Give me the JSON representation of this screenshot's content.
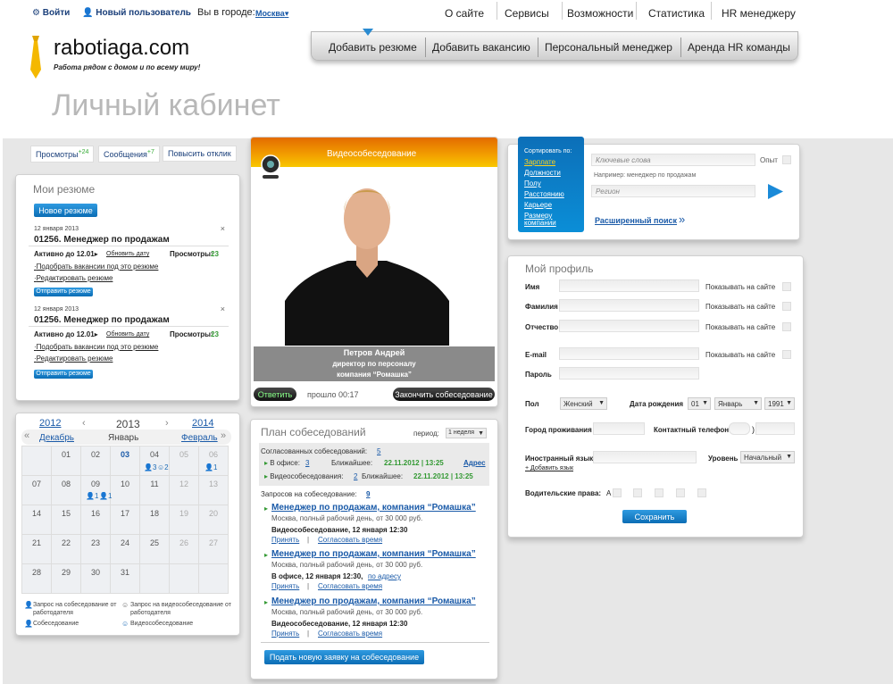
{
  "top": {
    "login": "Войти",
    "new_user": "Новый пользователь",
    "city_label": "Вы в городе:",
    "city": "Москва",
    "nav": [
      "О сайте",
      "Сервисы",
      "Возможности",
      "Статистика",
      "HR менеджеру"
    ]
  },
  "logo": {
    "name": "rabotiaga.com",
    "tagline": "Работа рядом с домом и по всему миру!"
  },
  "mainnav": [
    "Добавить резюме",
    "Добавить вакансию",
    "Персональный менеджер",
    "Аренда HR команды"
  ],
  "page_title": "Личный кабинет",
  "quick": {
    "views": "Просмотры",
    "views_count": "+24",
    "messages": "Сообщения",
    "messages_count": "+7",
    "boost": "Повысить отклик"
  },
  "resumes": {
    "title": "Мои резюме",
    "new_button": "Новое резюме",
    "items": [
      {
        "date": "12 января 2013",
        "title": "01256. Менеджер по продажам",
        "active": "Активно до 12.01",
        "update": "Обновить дату",
        "views_label": "Просмотры:",
        "views": "23",
        "match": "Подобрать вакансии под это резюме",
        "edit": "Редактировать резюме",
        "send": "Отправить резюме"
      },
      {
        "date": "12 января 2013",
        "title": "01256. Менеджер по продажам",
        "active": "Активно до 12.01",
        "update": "Обновить дату",
        "views_label": "Просмотры:",
        "views": "23",
        "match": "Подобрать вакансии под это резюме",
        "edit": "Редактировать резюме",
        "send": "Отправить резюме"
      }
    ]
  },
  "calendar": {
    "prev_year": "2012",
    "year": "2013",
    "next_year": "2014",
    "prev_month": "Декабрь",
    "month": "Январь",
    "next_month": "Февраль",
    "rows": [
      [
        "",
        "01",
        "02",
        "03",
        "04",
        "05",
        "06"
      ],
      [
        "07",
        "08",
        "09",
        "10",
        "11",
        "12",
        "13"
      ],
      [
        "14",
        "15",
        "16",
        "17",
        "18",
        "19",
        "20"
      ],
      [
        "21",
        "22",
        "23",
        "24",
        "25",
        "26",
        "27"
      ],
      [
        "28",
        "29",
        "30",
        "31",
        "",
        "",
        ""
      ]
    ],
    "badges": {
      "d04a": "3",
      "d04b": "2",
      "d06": "1",
      "d09": "1",
      "d10": "1"
    },
    "legend": {
      "employer_request": "Запрос на собеседование от работодателя",
      "video_request": "Запрос на видеособеседование от работодателя",
      "interview": "Собеседование",
      "video_interview": "Видеособеседование"
    }
  },
  "video": {
    "title": "Видеособеседование",
    "name": "Петров Андрей",
    "position": "директор по персоналу",
    "company": "компания “Ромашка”",
    "answer": "Ответить",
    "elapsed": "прошло 00:17",
    "end": "Закончить собеседование"
  },
  "plan": {
    "title": "План собеседований",
    "period_label": "период:",
    "period": "1 неделя",
    "agreed_label": "Согласованных собеседований:",
    "agreed": "5",
    "office_label": "В офисе:",
    "office_count": "3",
    "nearest_label": "Ближайшее:",
    "office_nearest": "22.11.2012 | 13:25",
    "address": "Адрес",
    "video_label": "Видеособеседования:",
    "video_count": "2",
    "video_nearest": "22.11.2012 | 13:25",
    "requests_label": "Запросов на собеседование:",
    "requests": "9",
    "items": [
      {
        "title": "Менеджер по продажам, компания “Ромашка”",
        "desc": "Москва, полный рабочий день, от 30 000 руб.",
        "when": "Видеособеседование, 12 января 12:30",
        "addr": "",
        "accept": "Принять",
        "other": "Согласовать время"
      },
      {
        "title": "Менеджер по продажам, компания “Ромашка”",
        "desc": "Москва, полный рабочий день, от 30 000 руб.",
        "when": "В офисе, 12 января 12:30,",
        "addr": "по адресу",
        "accept": "Принять",
        "other": "Согласовать время"
      },
      {
        "title": "Менеджер по продажам, компания “Ромашка”",
        "desc": "Москва, полный рабочий день, от 30 000 руб.",
        "when": "Видеособеседование, 12 января 12:30",
        "addr": "",
        "accept": "Принять",
        "other": "Согласовать время"
      }
    ],
    "new_request": "Подать новую заявку на собеседование"
  },
  "search": {
    "sort_label": "Сортировать по:",
    "sort_options": [
      "Зарплате",
      "Должности",
      "Полу",
      "Расстоянию",
      "Карьере",
      "Размеру компании"
    ],
    "keywords_placeholder": "Ключевые слова",
    "experience": "Опыт",
    "example": "Например: менеджер по продажам",
    "region_placeholder": "Регион",
    "advanced": "Расширенный поиск"
  },
  "profile": {
    "title": "Мой профиль",
    "show": "Показывать на сайте",
    "name": "Имя",
    "surname": "Фамилия",
    "patronymic": "Отчество",
    "email": "E-mail",
    "password": "Пароль",
    "gender_label": "Пол",
    "gender": "Женский",
    "birth_label": "Дата рождения",
    "birth_day": "01",
    "birth_month": "Январь",
    "birth_year": "1991",
    "city": "Город проживания",
    "phone": "Контактный телефон",
    "foreign_lang": "Иностранный язык",
    "level_label": "Уровень",
    "level": "Начальный",
    "add_lang": "+ Добавить язык",
    "license": "Водительские права:",
    "license_cat": "A",
    "save": "Сохранить"
  }
}
